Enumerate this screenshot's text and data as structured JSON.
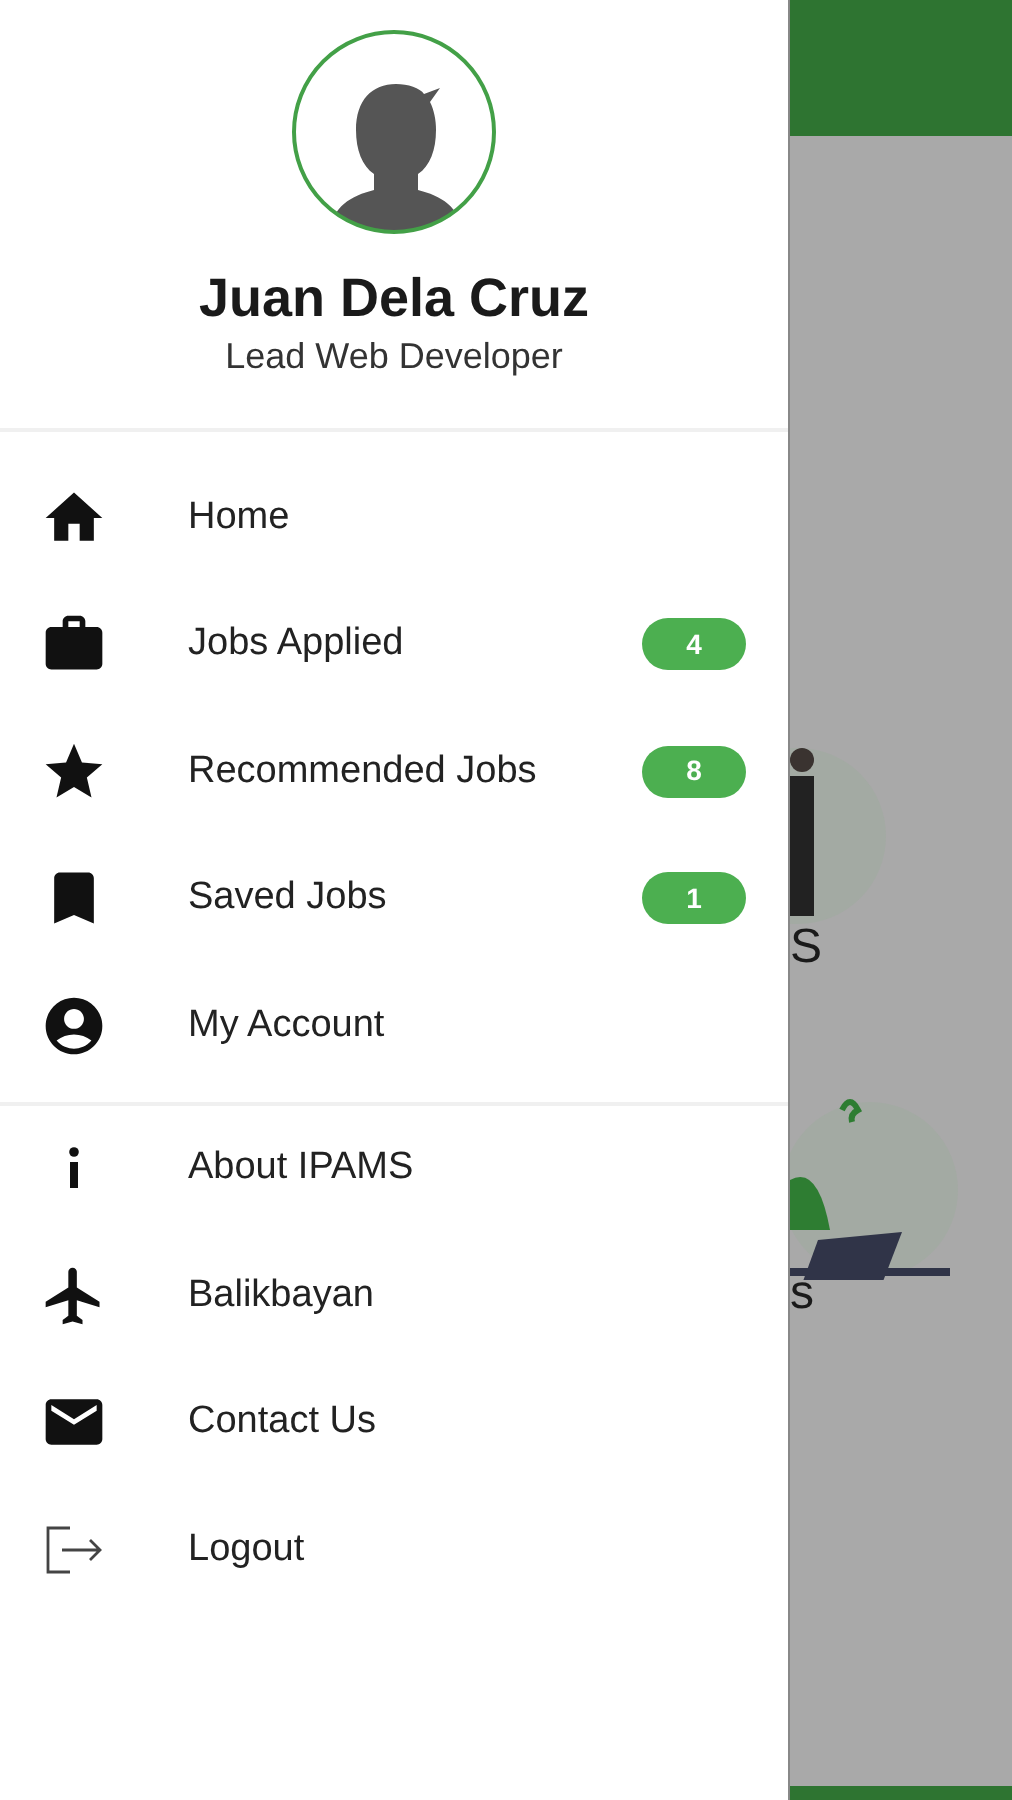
{
  "drawer": {
    "profile": {
      "name": "Juan Dela Cruz",
      "role": "Lead Web Developer"
    },
    "main_items": [
      {
        "label": "Home"
      },
      {
        "label": "Jobs Applied",
        "badge": "4"
      },
      {
        "label": "Recommended Jobs",
        "badge": "8"
      },
      {
        "label": "Saved Jobs",
        "badge": "1"
      },
      {
        "label": "My Account"
      }
    ],
    "other_items": [
      {
        "label": "About IPAMS"
      },
      {
        "label": "Balikbayan"
      },
      {
        "label": "Contact Us"
      },
      {
        "label": "Logout"
      }
    ]
  },
  "background_page": {
    "cards": [
      {
        "label": "S"
      },
      {
        "label": "s"
      }
    ]
  }
}
